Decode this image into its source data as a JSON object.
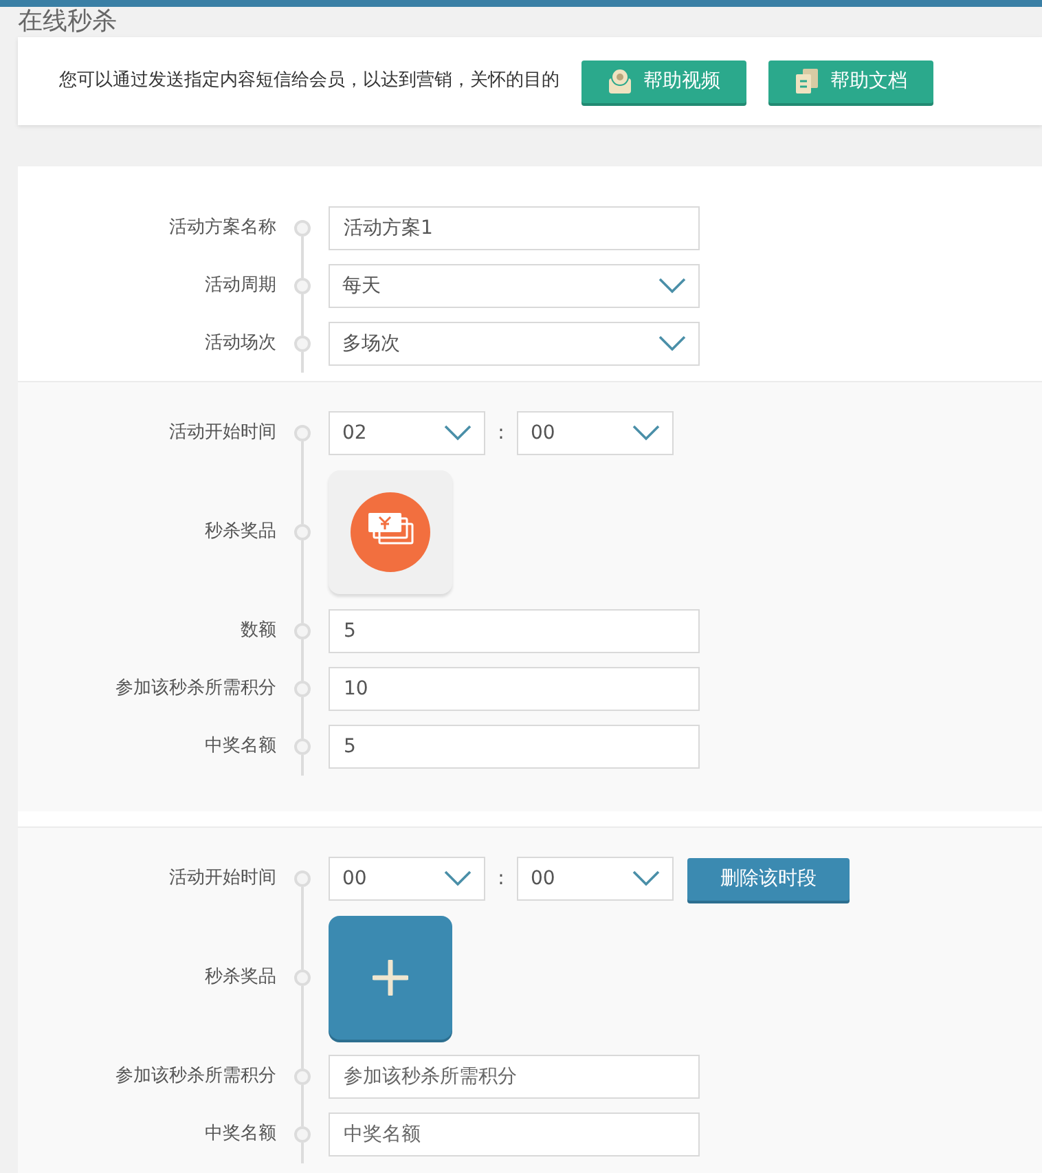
{
  "page_title": "在线秒杀",
  "notice": {
    "text": "您可以通过发送指定内容短信给会员，以达到营销，关怀的目的",
    "buttons": [
      {
        "kind": "video",
        "label": "帮助视频"
      },
      {
        "kind": "doc",
        "label": "帮助文档"
      }
    ]
  },
  "sections": [
    {
      "rows": [
        {
          "kind": "text",
          "label": "活动方案名称",
          "value": "活动方案1"
        },
        {
          "kind": "select",
          "label": "活动周期",
          "value": "每天"
        },
        {
          "kind": "select",
          "label": "活动场次",
          "value": "多场次"
        }
      ]
    },
    {
      "rows": [
        {
          "kind": "time",
          "label": "活动开始时间",
          "hour": "02",
          "separator": ":",
          "minute": "00"
        },
        {
          "kind": "prize",
          "label": "秒杀奖品"
        },
        {
          "kind": "text",
          "label": "数额",
          "value": "5"
        },
        {
          "kind": "text",
          "label": "参加该秒杀所需积分",
          "value": "10"
        },
        {
          "kind": "text",
          "label": "中奖名额",
          "value": "5"
        }
      ]
    },
    {
      "rows": [
        {
          "kind": "time",
          "label": "活动开始时间",
          "hour": "00",
          "separator": ":",
          "minute": "00",
          "delete_button": "删除该时段"
        },
        {
          "kind": "add_prize",
          "label": "秒杀奖品"
        },
        {
          "kind": "text",
          "label": "参加该秒杀所需积分",
          "placeholder": "参加该秒杀所需积分"
        },
        {
          "kind": "text",
          "label": "中奖名额",
          "placeholder": "中奖名额"
        }
      ]
    }
  ]
}
